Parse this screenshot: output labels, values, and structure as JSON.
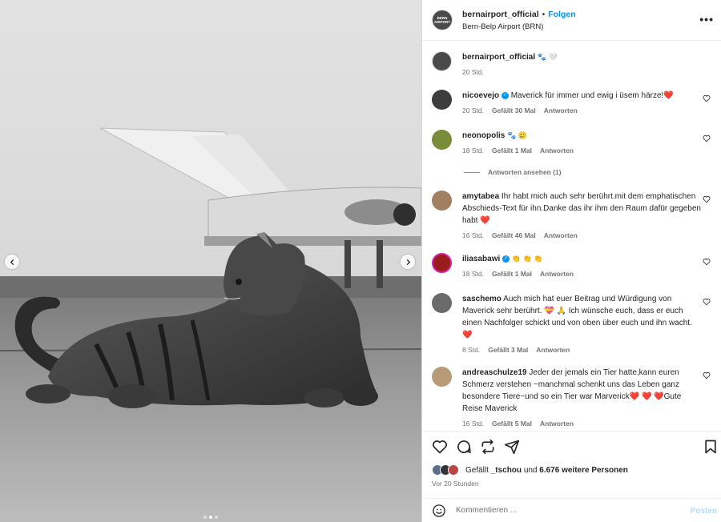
{
  "header": {
    "username": "bernairport_official",
    "separator": "•",
    "follow_label": "Folgen",
    "location": "Bern-Belp Airport (BRN)",
    "more_icon": "more-horizontal-icon",
    "logo_text": "BERN AIRPORT"
  },
  "caption": {
    "username": "bernairport_official",
    "text": "🐾 🤍",
    "time": "20 Std."
  },
  "comments": [
    {
      "username": "nicoevejo",
      "verified": true,
      "text": "Maverick für immer und ewig i üsem härze!",
      "trail": "❤️",
      "time": "20 Std.",
      "likes": "Gefällt 30 Mal",
      "reply": "Antworten"
    },
    {
      "username": "neonopolis",
      "verified": false,
      "text": "🐾 🥲",
      "trail": "",
      "time": "18 Std.",
      "likes": "Gefällt 1 Mal",
      "reply": "Antworten"
    },
    {
      "username": "amytabea",
      "verified": false,
      "text": "Ihr habt mich auch sehr berührt.mit dem emphatischen Abschieds-Text für ihn.Danke das ihr ihm den Raum dafür gegeben habt",
      "trail": "❤️",
      "time": "16 Std.",
      "likes": "Gefällt 46 Mal",
      "reply": "Antworten"
    },
    {
      "username": "iliasabawi",
      "verified": true,
      "text": "👏 👏 👏",
      "trail": "",
      "time": "18 Std.",
      "likes": "Gefällt 1 Mal",
      "reply": "Antworten"
    },
    {
      "username": "saschemo",
      "verified": false,
      "text": "Auch mich hat euer Beitrag und Würdigung von Maverick sehr berührt. 💝 🙏 Ich wünsche euch, dass er euch einen Nachfolger schickt und von oben über euch und ihn wacht.",
      "trail": "❤️",
      "time": "8 Std.",
      "likes": "Gefällt 3 Mal",
      "reply": "Antworten"
    },
    {
      "username": "andreaschulze19",
      "verified": false,
      "text": "Jeder der jemals ein Tier hatte,kann euren Schmerz verstehen ~manchmal schenkt uns das Leben ganz besondere Tiere~und so ein Tier war Marverick❤️ ❤️ ❤️Gute Reise Maverick",
      "trail": "",
      "time": "16 Std.",
      "likes": "Gefällt 5 Mal",
      "reply": "Antworten"
    }
  ],
  "view_replies": "Antworten ansehen (1)",
  "likes_line": {
    "prefix": "Gefällt",
    "user": "_tschou",
    "middle": "und",
    "count": "6.676 weitere Personen"
  },
  "posted_ago": "Vor 20 Stunden",
  "composer": {
    "placeholder": "Kommentieren ...",
    "post_label": "Posten"
  },
  "carousel": {
    "slides": 3,
    "active": 2
  },
  "colors": {
    "accent": "#0095f6",
    "like_red": "#ed4956",
    "muted": "#737373"
  }
}
